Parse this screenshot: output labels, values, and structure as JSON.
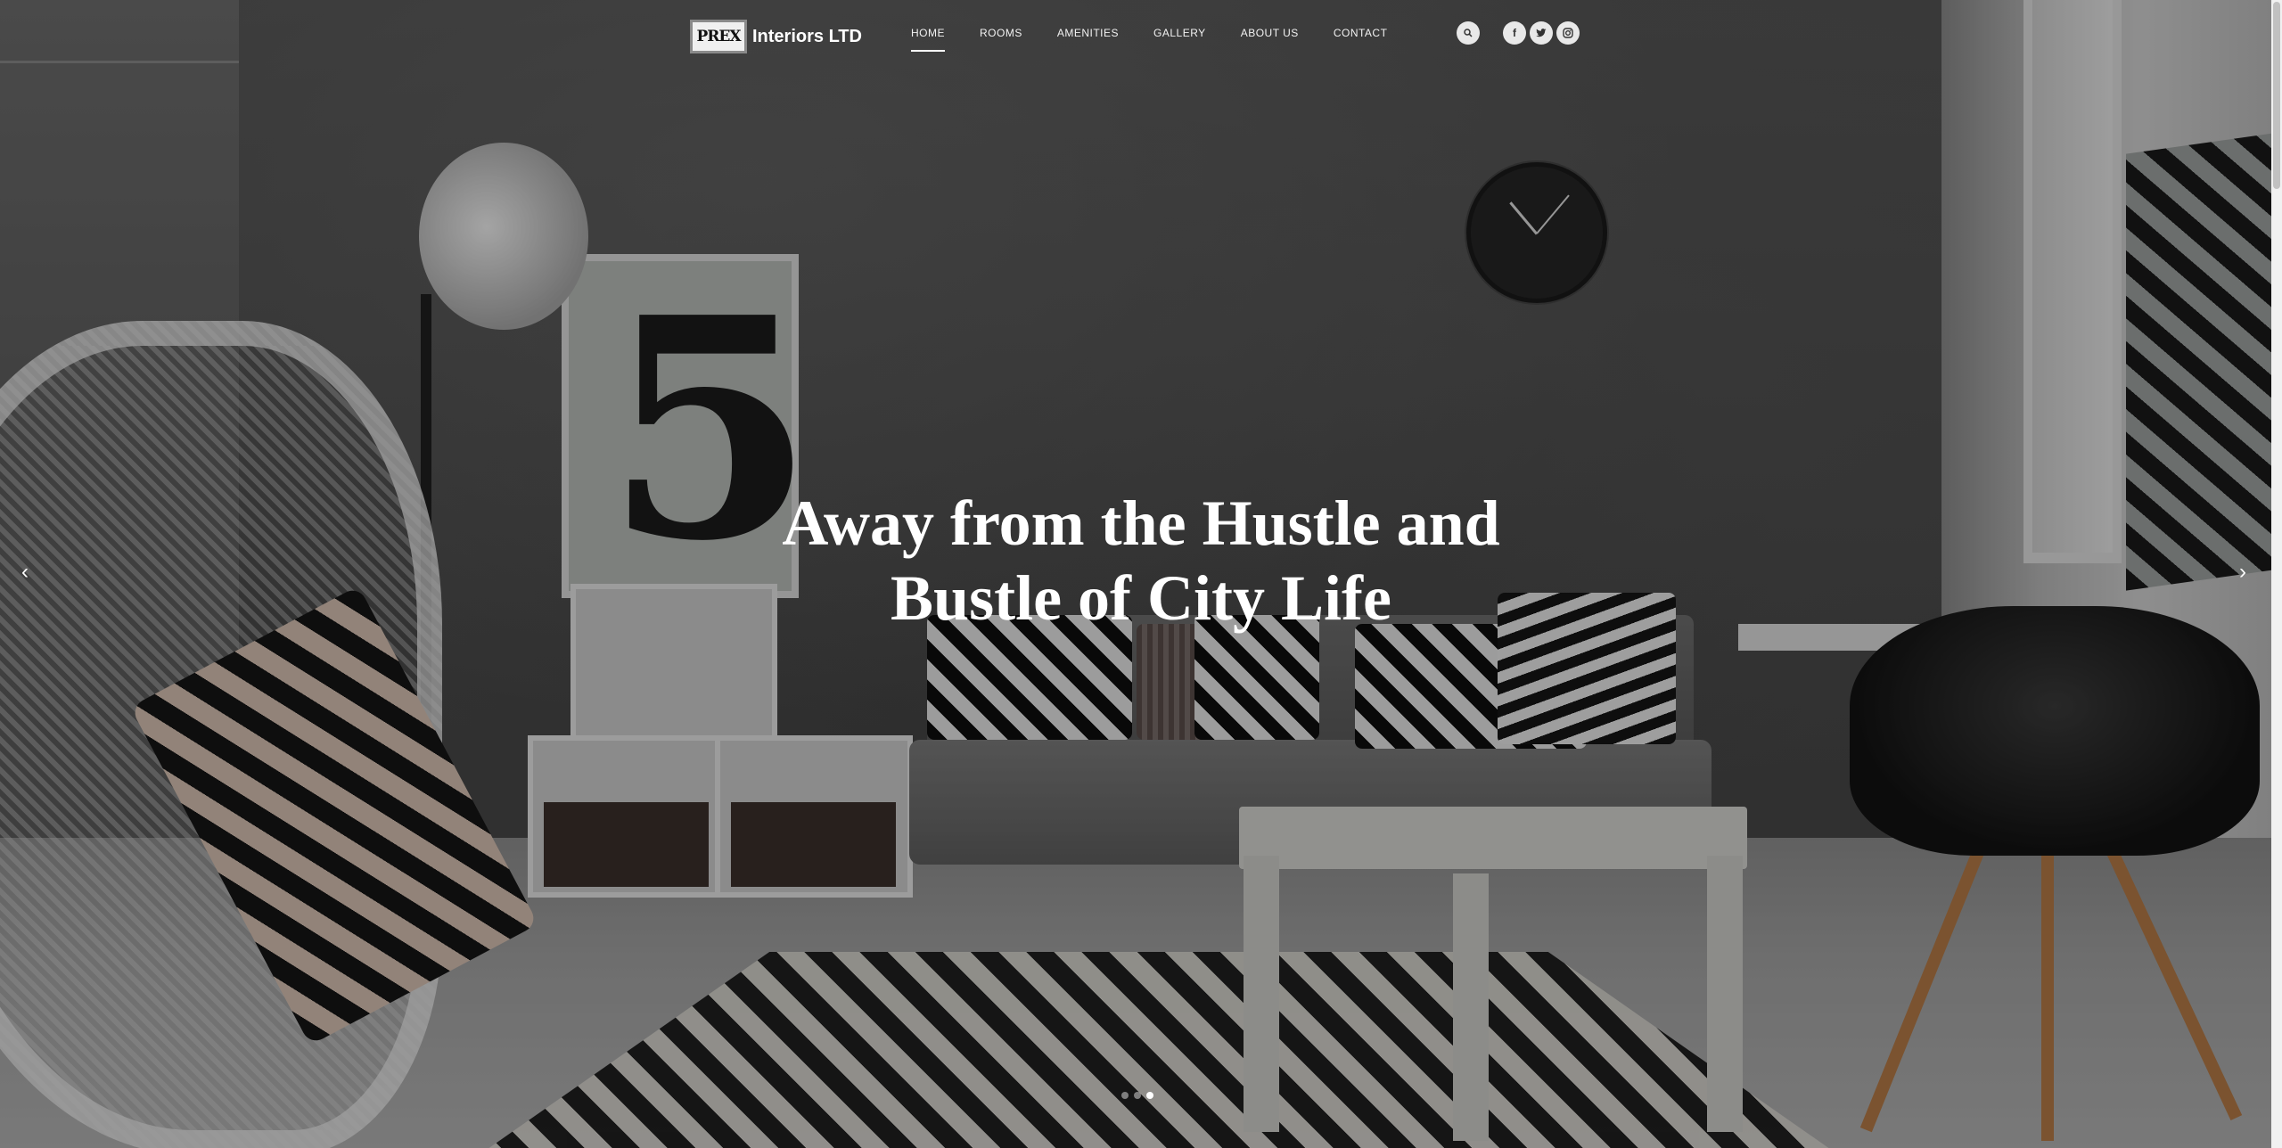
{
  "brand": {
    "logo_mark": "PREX",
    "name": "Interiors LTD"
  },
  "nav": {
    "items": [
      {
        "label": "HOME",
        "active": true
      },
      {
        "label": "ROOMS",
        "active": false
      },
      {
        "label": "AMENITIES",
        "active": false
      },
      {
        "label": "GALLERY",
        "active": false
      },
      {
        "label": "ABOUT US",
        "active": false
      },
      {
        "label": "CONTACT",
        "active": false
      }
    ]
  },
  "header_actions": {
    "search_icon": "🔍",
    "facebook_icon": "f",
    "twitter_icon": "🐦",
    "instagram_icon": "◎"
  },
  "hero": {
    "headline_line1": "Away from the Hustle and",
    "headline_line2": "Bustle of City Life",
    "prev_arrow": "‹",
    "next_arrow": "›",
    "slides": 3,
    "active_slide": 3
  },
  "colors": {
    "text": "#ffffff",
    "overlay": "rgba(0,0,0,0.32)"
  }
}
